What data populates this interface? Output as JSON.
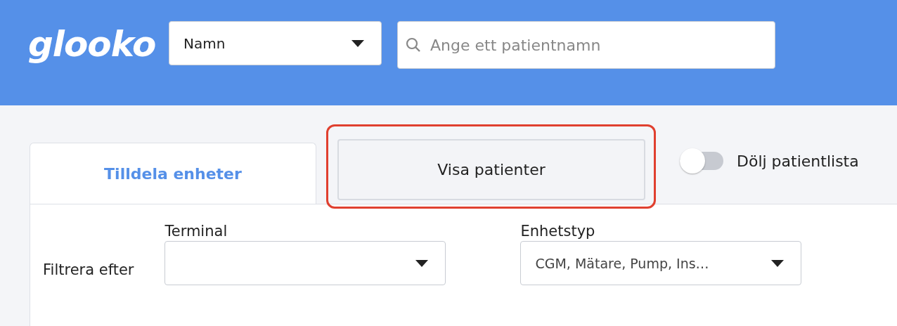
{
  "header": {
    "logo": "glooko",
    "search_by": {
      "value": "Namn"
    },
    "search": {
      "placeholder": "Ange ett patientnamn"
    }
  },
  "tabs": [
    {
      "label": "Tilldela enheter",
      "selected": true,
      "highlighted": false
    },
    {
      "label": "Visa patienter",
      "selected": false,
      "highlighted": true
    }
  ],
  "toggle": {
    "label": "Dölj patientlista",
    "on": false
  },
  "filter": {
    "label": "Filtrera efter",
    "fields": [
      {
        "label": "Terminal"
      },
      {
        "label": "Enhetstyp",
        "value": "CGM, Mätare, Pump, Ins…"
      }
    ]
  }
}
